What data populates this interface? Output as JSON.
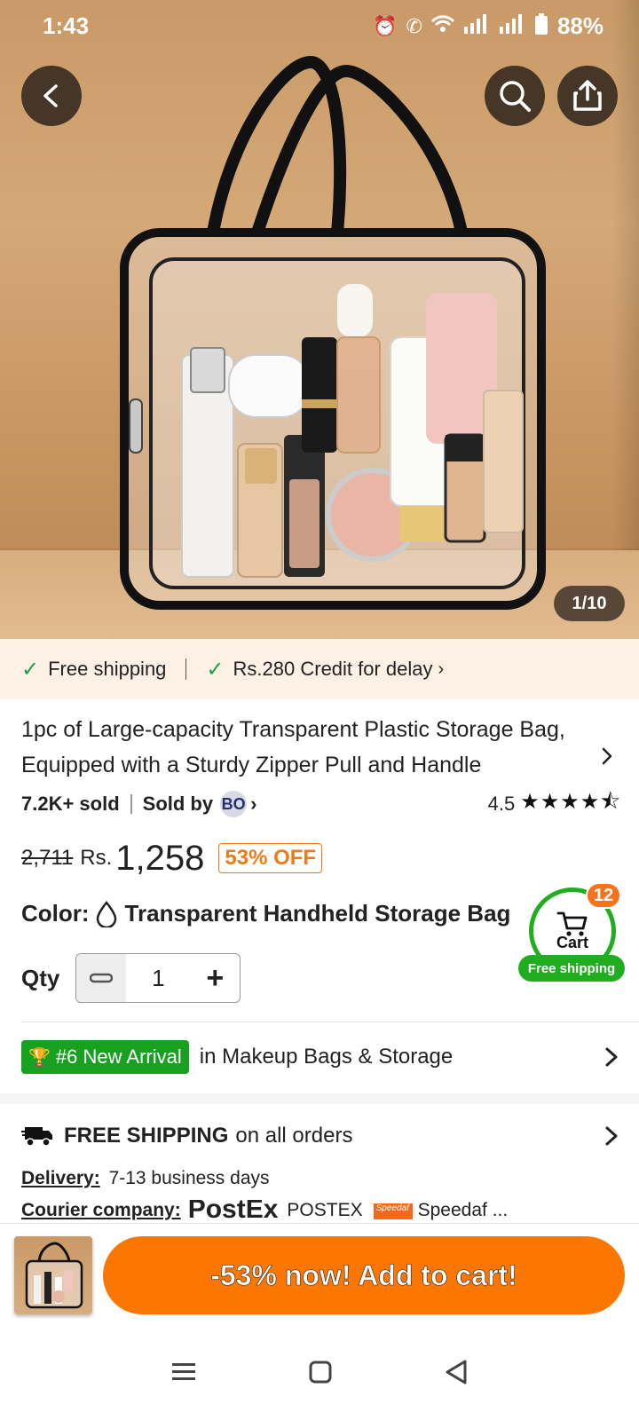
{
  "status_bar": {
    "time": "1:43",
    "battery": "88%"
  },
  "product_images": {
    "counter": "1/10"
  },
  "benefits": {
    "free_shipping": "Free shipping",
    "credit": "Rs.280 Credit for delay"
  },
  "product": {
    "title": "1pc of Large-capacity Transparent Plastic Storage Bag, Equipped with a Sturdy Zipper Pull and Handle",
    "sold": "7.2K+ sold",
    "sold_by_label": "Sold by",
    "seller_badge": "BO",
    "rating": "4.5",
    "old_price": "2,711",
    "currency": "Rs.",
    "price": "1,258",
    "discount": "53% OFF",
    "color_label": "Color:",
    "color_value": "Transparent Handheld Storage Bag",
    "qty_label": "Qty",
    "qty_value": "1"
  },
  "cart": {
    "count": "12",
    "label": "Cart",
    "badge": "Free shipping"
  },
  "rank": {
    "badge": "#6 New Arrival",
    "text": "in Makeup Bags & Storage"
  },
  "shipping": {
    "bold": "FREE SHIPPING",
    "rest": "on all orders",
    "delivery_label": "Delivery:",
    "delivery_value": "7-13 business days",
    "courier_label": "Courier company:",
    "courier_logo": "PostEx",
    "courier_1": "POSTEX",
    "courier_logo_2": "Speedaf",
    "courier_2": "Speedaf ..."
  },
  "cta": {
    "label": "-53% now! Add to cart!"
  },
  "colors": {
    "accent_orange": "#fb7701",
    "success_green": "#20ad20",
    "benefit_bg": "#fdf1e6"
  }
}
